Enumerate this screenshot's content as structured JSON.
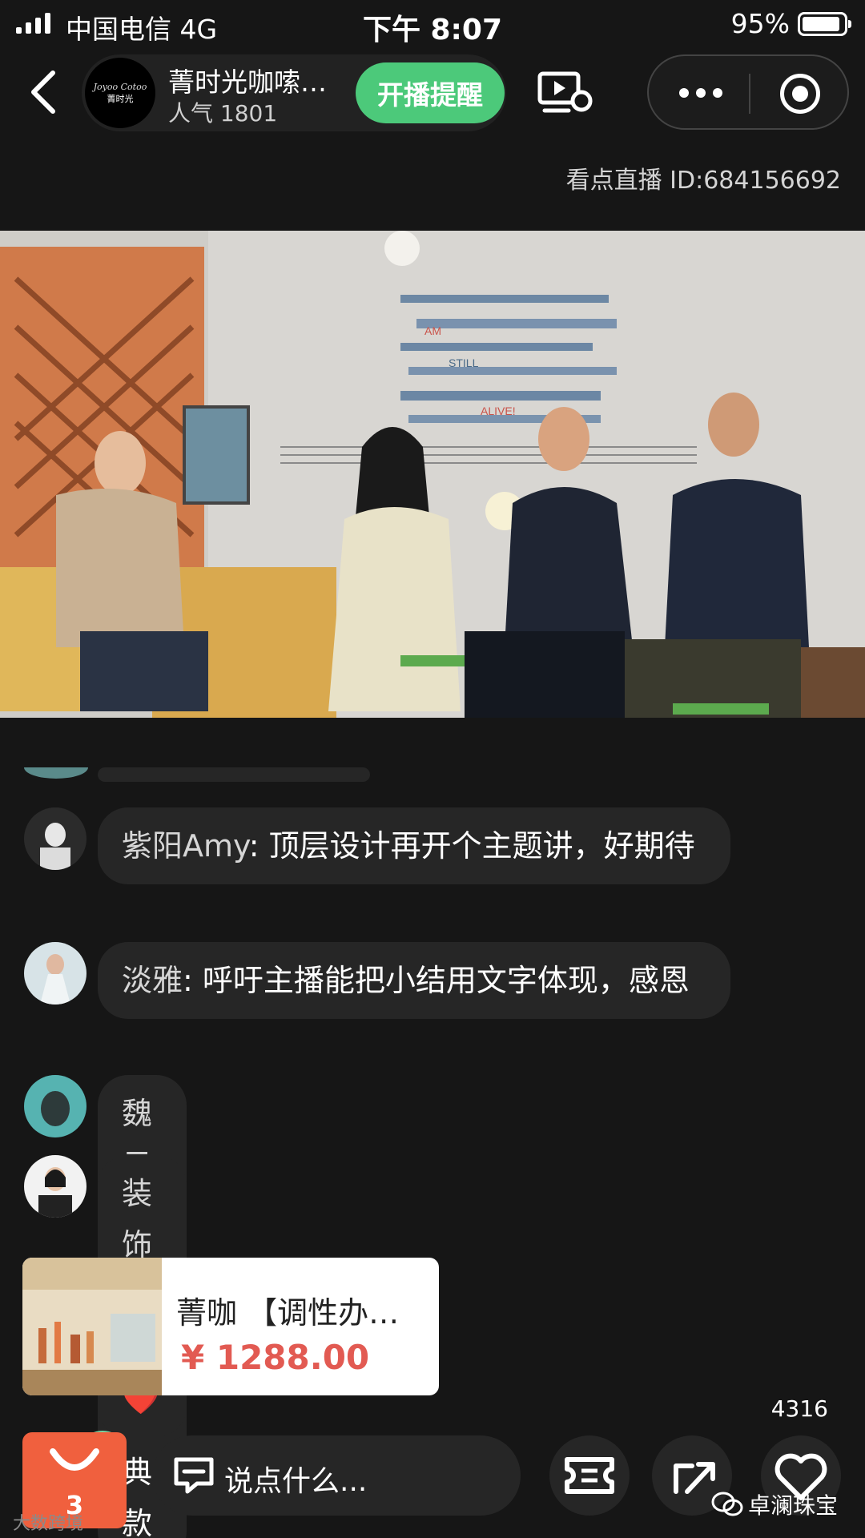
{
  "status_bar": {
    "carrier": "中国电信  4G",
    "time": "下午 8:07",
    "battery": "95%",
    "battery_level": 0.95
  },
  "header": {
    "anchor_name": "菁时光咖嗦…",
    "popularity": "人气 1801",
    "remind_button": "开播提醒",
    "avatar_text_line1": "Joyoo Cotoo",
    "avatar_text_line2": "菁时光"
  },
  "live_id": "看点直播 ID:684156692",
  "video": {
    "wall_text": [
      "AM",
      "STILL",
      "ALIVE!"
    ]
  },
  "chat": [
    {
      "user": "紫阳Amy",
      "message": "顶层设计再开个主题讲，好期待"
    },
    {
      "user": "淡雅",
      "message": "呼吁主播能把小结用文字体现，感恩"
    },
    {
      "user": "魏云辉",
      "message": "爆款&经典款"
    },
    {
      "user": "装饰唐捷",
      "message": "❤️"
    }
  ],
  "product": {
    "title": "菁咖 【调性办…",
    "price": "¥ 1288.00"
  },
  "bottom": {
    "likes": "4316",
    "cart_count": "3",
    "comment_placeholder": "说点什么...",
    "watermark": "卓澜珠宝",
    "watermark2": "大数跨境"
  },
  "colors": {
    "remind_green": "#4cc97a",
    "price_red": "#e25a52",
    "cart_orange": "#f0603e",
    "background": "#161616"
  }
}
